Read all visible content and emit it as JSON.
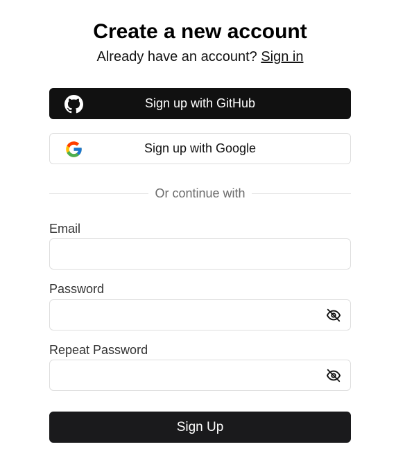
{
  "header": {
    "title": "Create a new account",
    "subtitle_prefix": "Already have an account?",
    "signin_link": "Sign in"
  },
  "social": {
    "github_label": "Sign up with GitHub",
    "google_label": "Sign up with Google",
    "github_icon": "github-icon",
    "google_icon": "google-icon"
  },
  "divider": {
    "text": "Or continue with"
  },
  "form": {
    "email_label": "Email",
    "email_value": "",
    "password_label": "Password",
    "password_value": "",
    "repeat_password_label": "Repeat Password",
    "repeat_password_value": "",
    "visibility_icon": "eye-off-icon",
    "submit_label": "Sign Up"
  },
  "colors": {
    "primary_button": "#111111",
    "submit_button": "#1a1a1c",
    "border": "#dedede",
    "muted_text": "#6b6b6b"
  }
}
